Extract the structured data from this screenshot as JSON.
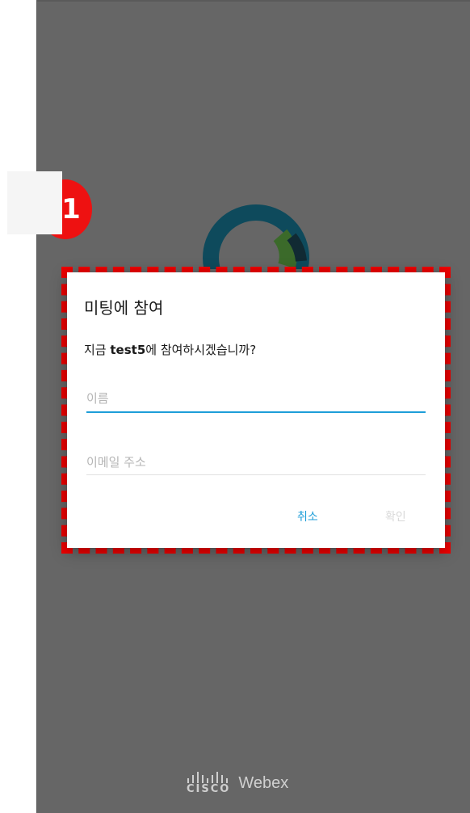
{
  "step_badge": "1",
  "dialog": {
    "title": "미팅에 참여",
    "message_prefix": "지금 ",
    "meeting_name": "test5",
    "message_suffix": "에 참여하시겠습니까?",
    "name_placeholder": "이름",
    "email_placeholder": "이메일 주소",
    "cancel_label": "취소",
    "confirm_label": "확인"
  },
  "footer": {
    "cisco_label": "CISCO",
    "webex_label": "Webex"
  },
  "colors": {
    "accent": "#1e9ed8",
    "overlay": "#666666",
    "highlight": "#ee0000"
  }
}
